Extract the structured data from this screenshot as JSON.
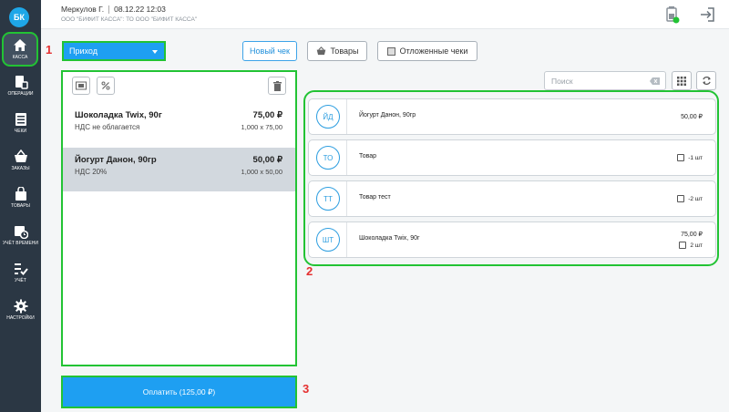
{
  "sidebar": {
    "avatar": "БК",
    "items": [
      {
        "label": "КАССА",
        "icon": "home-icon"
      },
      {
        "label": "ОПЕРАЦИИ",
        "icon": "operations-icon"
      },
      {
        "label": "ЧЕКИ",
        "icon": "receipts-icon"
      },
      {
        "label": "ЗАКАЗЫ",
        "icon": "basket-icon"
      },
      {
        "label": "ТОВАРЫ",
        "icon": "bag-icon"
      },
      {
        "label": "УЧЁТ ВРЕМЕНИ",
        "icon": "calendar-clock-icon"
      },
      {
        "label": "УЧЁТ",
        "icon": "checklist-icon"
      },
      {
        "label": "НАСТРОЙКИ",
        "icon": "gear-icon"
      }
    ]
  },
  "header": {
    "user": "Меркулов Г.",
    "datetime": "08.12.22 12:03",
    "org": "ООО \"БИФИТ КАССА\": ТО ООО \"БИФИТ КАССА\""
  },
  "annotations": {
    "one": "1",
    "two": "2",
    "three": "3"
  },
  "toolbar": {
    "operation_type": "Приход",
    "new_receipt": "Новый чек",
    "goods": "Товары",
    "deferred": "Отложенные чеки"
  },
  "receipt": {
    "items": [
      {
        "name": "Шоколадка Twix, 90г",
        "vat": "НДС не облагается",
        "price": "75,00 ₽",
        "qty": "1,000 x 75,00"
      },
      {
        "name": "Йогурт Данон, 90гр",
        "vat": "НДС 20%",
        "price": "50,00 ₽",
        "qty": "1,000 x 50,00"
      }
    ]
  },
  "pay_label": "Оплатить (125,00 ₽)",
  "search": {
    "placeholder": "Поиск"
  },
  "catalog": {
    "items": [
      {
        "initials": "ЙД",
        "name": "Йогурт Данон, 90гр",
        "price": "50,00 ₽",
        "qty": ""
      },
      {
        "initials": "ТО",
        "name": "Товар",
        "price": "",
        "qty": "-1 шт"
      },
      {
        "initials": "ТТ",
        "name": "Товар тест",
        "price": "",
        "qty": "-2 шт"
      },
      {
        "initials": "ШТ",
        "name": "Шоколадка Twix, 90г",
        "price": "75,00 ₽",
        "qty": "2 шт"
      }
    ]
  },
  "colors": {
    "accent": "#1e9ff2",
    "highlight": "#22c334",
    "sidebar": "#2b3744",
    "marker": "#e53030"
  }
}
